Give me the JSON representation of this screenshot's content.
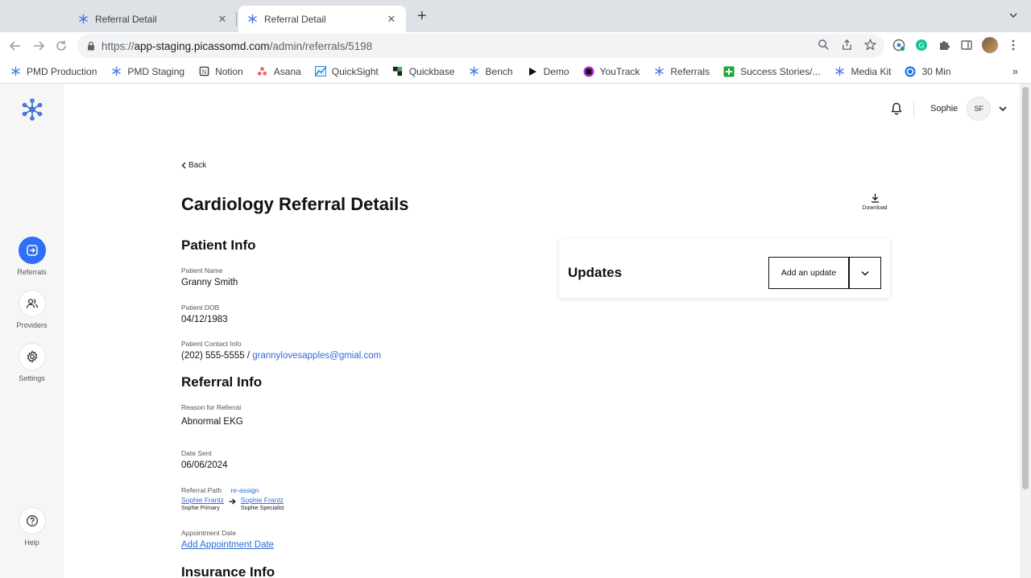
{
  "browser": {
    "tabs": [
      {
        "title": "Referral Detail",
        "active": false
      },
      {
        "title": "Referral Detail",
        "active": true
      }
    ],
    "url": {
      "scheme": "https://",
      "host": "app-staging.picassomd.com",
      "path": "/admin/referrals/5198"
    },
    "bookmarks": [
      {
        "label": "PMD Production",
        "icon": "pmd-snowflake-icon"
      },
      {
        "label": "PMD Staging",
        "icon": "pmd-snowflake-icon"
      },
      {
        "label": "Notion",
        "icon": "notion-icon"
      },
      {
        "label": "Asana",
        "icon": "asana-icon"
      },
      {
        "label": "QuickSight",
        "icon": "quicksight-icon"
      },
      {
        "label": "Quickbase",
        "icon": "quickbase-icon"
      },
      {
        "label": "Bench",
        "icon": "pmd-snowflake-icon"
      },
      {
        "label": "Demo",
        "icon": "play-icon"
      },
      {
        "label": "YouTrack",
        "icon": "youtrack-icon"
      },
      {
        "label": "Referrals",
        "icon": "pmd-snowflake-icon"
      },
      {
        "label": "Success Stories/...",
        "icon": "green-plus-icon"
      },
      {
        "label": "Media Kit",
        "icon": "pmd-snowflake-icon"
      },
      {
        "label": "30 Min",
        "icon": "calendly-icon"
      }
    ],
    "bookmarks_more": "»"
  },
  "sidebar": {
    "items": [
      {
        "label": "Referrals",
        "icon": "referrals-icon",
        "active": true
      },
      {
        "label": "Providers",
        "icon": "providers-icon",
        "active": false
      },
      {
        "label": "Settings",
        "icon": "gear-icon",
        "active": false
      }
    ],
    "help_label": "Help"
  },
  "header": {
    "user_name": "Sophie",
    "user_initials": "SF"
  },
  "page": {
    "back_label": "Back",
    "title": "Cardiology Referral Details",
    "download_label": "Download",
    "patient_info": {
      "heading": "Patient Info",
      "name_label": "Patient Name",
      "name": "Granny Smith",
      "dob_label": "Patient DOB",
      "dob": "04/12/1983",
      "contact_label": "Patient Contact Info",
      "phone": "(202) 555-5555",
      "separator": " / ",
      "email": "grannylovesapples@gmial.com"
    },
    "referral_info": {
      "heading": "Referral Info",
      "reason_label": "Reason for Referral",
      "reason": "Abnormal EKG",
      "date_sent_label": "Date Sent",
      "date_sent": "06/06/2024",
      "path_label": "Referral Path",
      "reassign_label": "re-assign",
      "from_name": "Sophie Frantz",
      "from_role": "Sophie Primary",
      "to_name": "Sophie Frantz",
      "to_role": "Sophie Specialist",
      "appointment_label": "Appointment Date",
      "add_appointment": "Add Appointment Date"
    },
    "insurance_info": {
      "heading": "Insurance Info"
    },
    "updates": {
      "title": "Updates",
      "add_button": "Add an update"
    }
  },
  "colors": {
    "accent": "#2f6ef5",
    "link": "#2f6ad6",
    "sidebar_bg": "#f6f6f6"
  }
}
